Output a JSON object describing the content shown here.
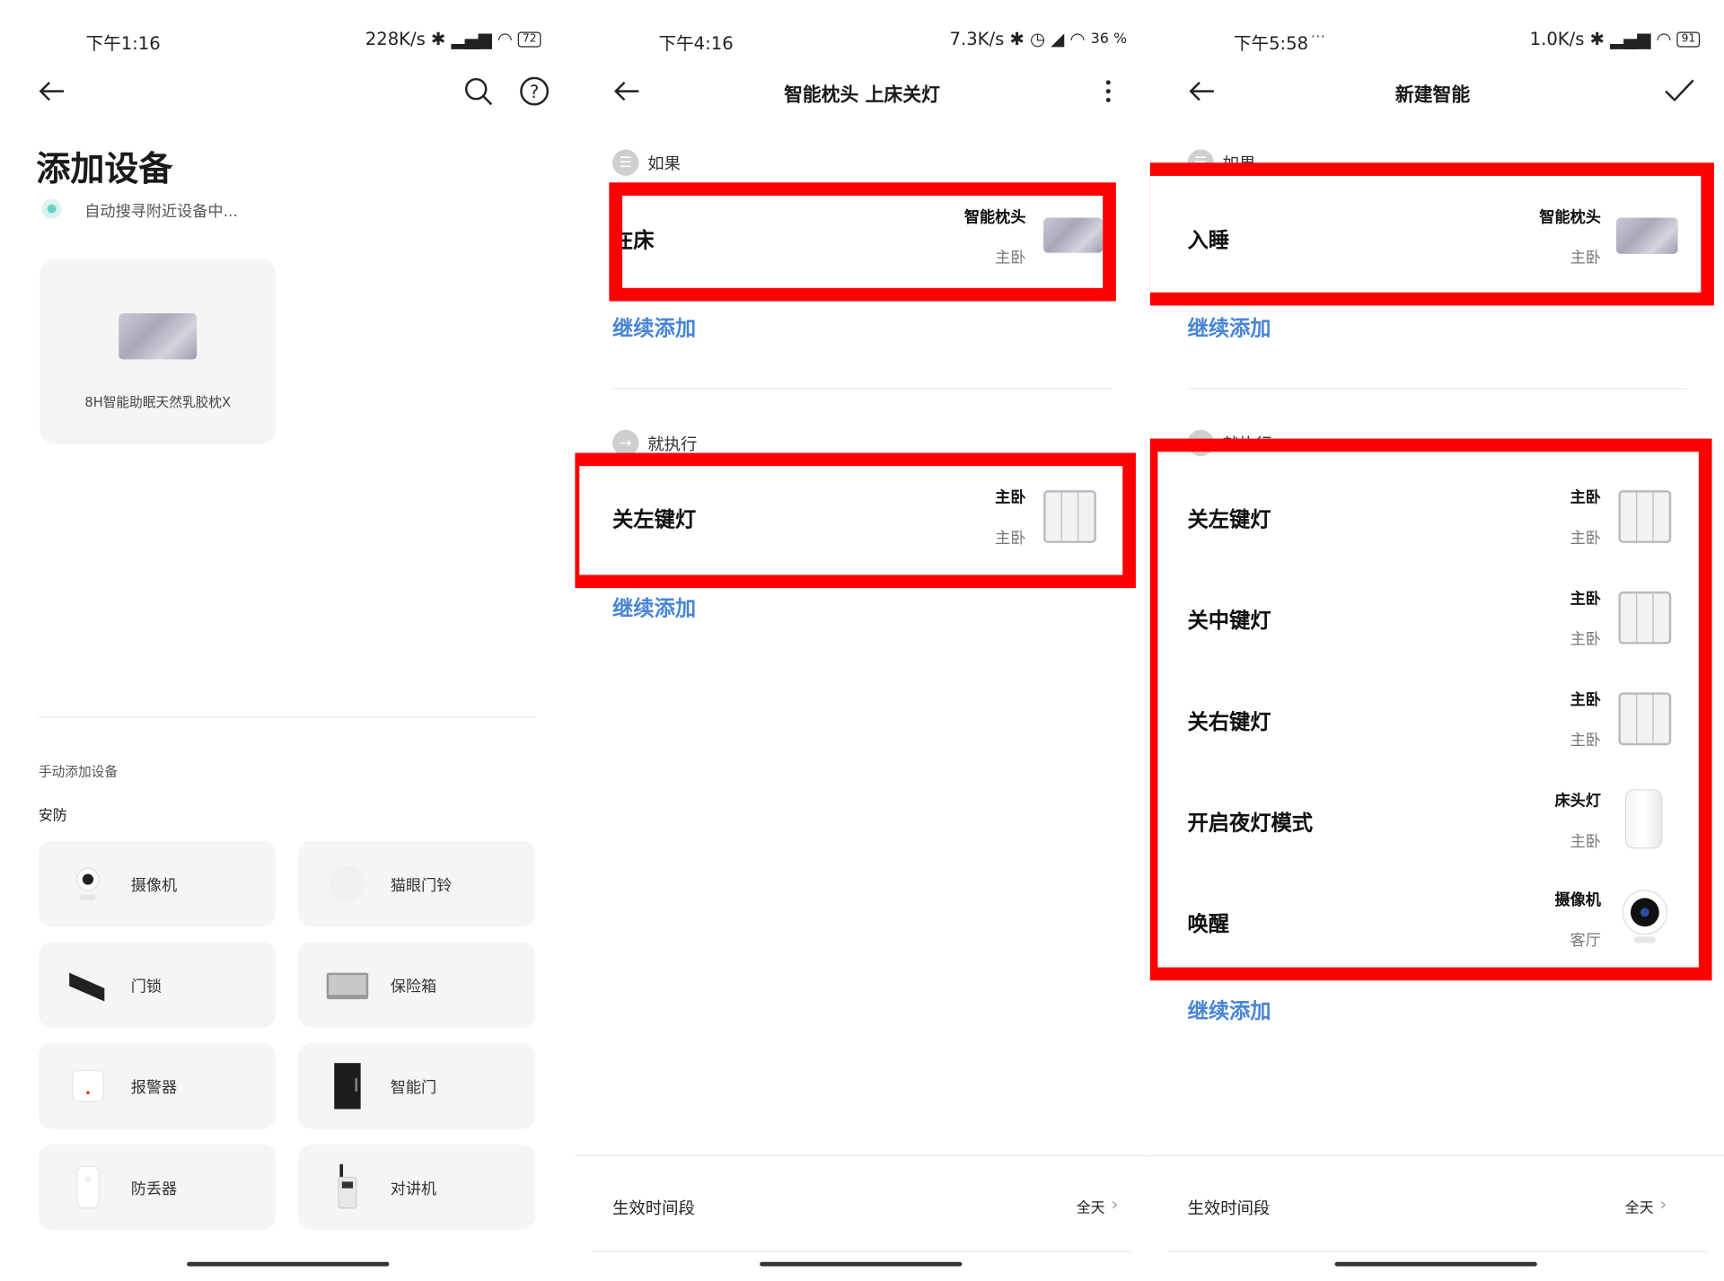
{
  "panel1": {
    "status": {
      "time": "下午1:16",
      "speed": "228K/s",
      "battery": "72"
    },
    "title": "添加设备",
    "searching": "自动搜寻附近设备中...",
    "found_device": "8H智能助眠天然乳胶枕X",
    "manual_title": "手动添加设备",
    "category": "安防",
    "items": [
      {
        "label": "摄像机",
        "icon": "camera-icon"
      },
      {
        "label": "猫眼门铃",
        "icon": "peephole-doorbell-icon"
      },
      {
        "label": "门锁",
        "icon": "door-lock-icon"
      },
      {
        "label": "保险箱",
        "icon": "safe-icon"
      },
      {
        "label": "报警器",
        "icon": "alarm-icon"
      },
      {
        "label": "智能门",
        "icon": "smart-door-icon"
      },
      {
        "label": "防丢器",
        "icon": "anti-loss-icon"
      },
      {
        "label": "对讲机",
        "icon": "walkie-talkie-icon"
      }
    ]
  },
  "panel2": {
    "status": {
      "time": "下午4:16",
      "speed": "7.3K/s",
      "battery": "36 %"
    },
    "title": "智能枕头  上床关灯",
    "if_label": "如果",
    "if_row": {
      "label": "在床",
      "device": "智能枕头",
      "room": "主卧"
    },
    "add_more": "继续添加",
    "then_label": "就执行",
    "then_row": {
      "label": "关左键灯",
      "device": "主卧",
      "room": "主卧"
    },
    "add_more2": "继续添加",
    "footer_label": "生效时间段",
    "footer_value": "全天"
  },
  "panel3": {
    "status": {
      "time": "下午5:58",
      "speed": "1.0K/s",
      "battery": "91"
    },
    "title": "新建智能",
    "if_label": "如果",
    "if_row": {
      "label": "入睡",
      "device": "智能枕头",
      "room": "主卧"
    },
    "add_more": "继续添加",
    "then_label": "就执行",
    "then_rows": [
      {
        "label": "关左键灯",
        "device": "主卧",
        "room": "主卧"
      },
      {
        "label": "关中键灯",
        "device": "主卧",
        "room": "主卧"
      },
      {
        "label": "关右键灯",
        "device": "主卧",
        "room": "主卧"
      },
      {
        "label": "开启夜灯模式",
        "device": "床头灯",
        "room": "主卧"
      },
      {
        "label": "唤醒",
        "device": "摄像机",
        "room": "客厅"
      }
    ],
    "add_more2": "继续添加",
    "footer_label": "生效时间段",
    "footer_value": "全天"
  },
  "colors": {
    "accent": "#4a86d6",
    "highlight": "#ff0000",
    "tile": "#f5f5f5"
  }
}
